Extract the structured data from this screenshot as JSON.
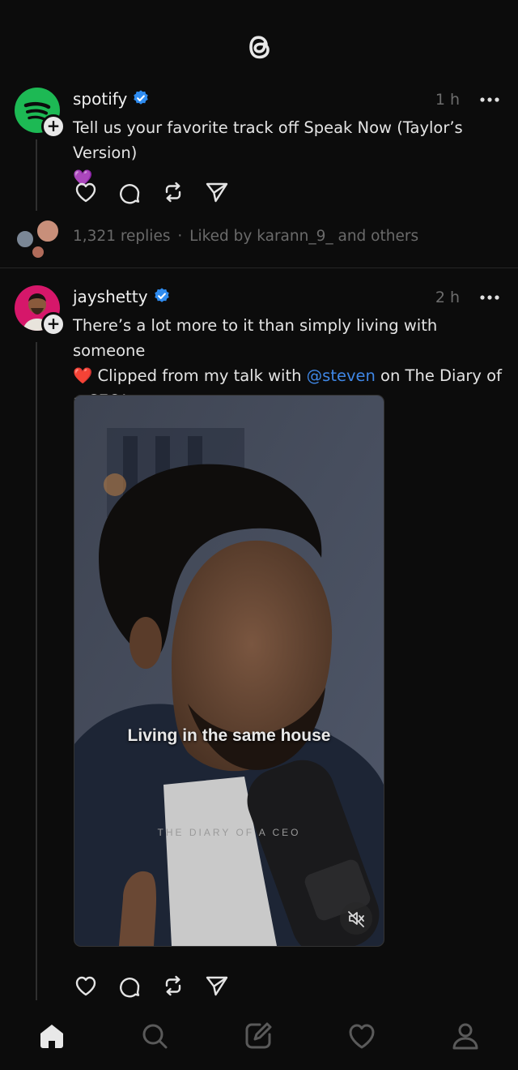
{
  "app": {
    "logo_icon": "threads-logo-icon"
  },
  "posts": [
    {
      "username": "spotify",
      "verified": true,
      "time": "1 h",
      "text": "Tell us your favorite track off Speak Now (Taylor’s Version)",
      "emoji": "💜",
      "replies": "1,321 replies",
      "separator": "·",
      "liked_by": "Liked by karann_9_ and others",
      "accent_color": "#1DB954"
    },
    {
      "username": "jayshetty",
      "verified": true,
      "time": "2 h",
      "text_line1": "There’s a lot more to it than simply living with someone",
      "emoji": "❤️",
      "text_pre_mention": " Clipped from my talk with ",
      "mention": "@steven",
      "text_post_mention": " on The Diary of a CEO!",
      "video": {
        "caption": "Living in the same house",
        "watermark": "THE DIARY OF A CEO",
        "mute_icon": "speaker-muted-icon"
      }
    }
  ],
  "tabbar": {
    "items": [
      "home-icon",
      "search-icon",
      "compose-icon",
      "activity-heart-icon",
      "profile-icon"
    ],
    "active": "home-icon"
  },
  "colors": {
    "link": "#3f87e6",
    "verified": "#2f8cf0",
    "background": "#0c0c0c"
  }
}
